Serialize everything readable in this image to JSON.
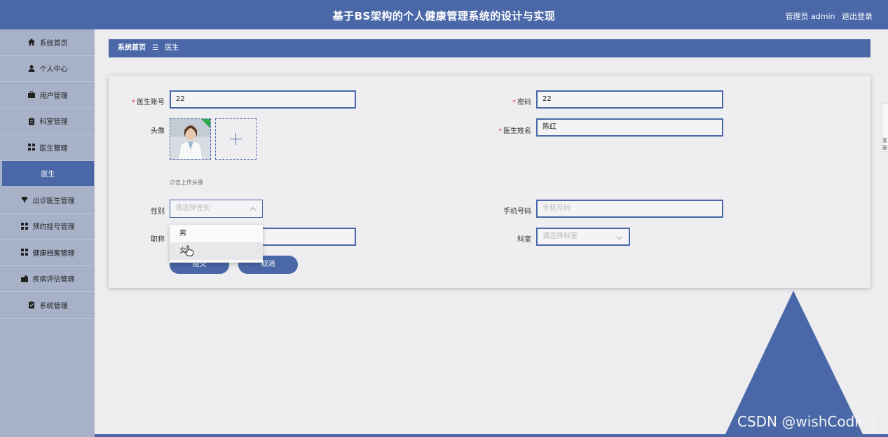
{
  "header": {
    "title": "基于BS架构的个人健康管理系统的设计与实现",
    "user_label": "管理员 admin",
    "logout_label": "退出登录"
  },
  "sidebar": {
    "items": [
      {
        "label": "系统首页",
        "icon": "home-icon"
      },
      {
        "label": "个人中心",
        "icon": "user-icon"
      },
      {
        "label": "用户管理",
        "icon": "briefcase-icon"
      },
      {
        "label": "科室管理",
        "icon": "clipboard-icon"
      },
      {
        "label": "医生管理",
        "icon": "grid-icon"
      },
      {
        "label": "医生",
        "icon": ""
      },
      {
        "label": "出诊医生管理",
        "icon": "cup-icon"
      },
      {
        "label": "预约挂号管理",
        "icon": "grid-icon"
      },
      {
        "label": "健康档案管理",
        "icon": "grid-icon"
      },
      {
        "label": "疾病评估管理",
        "icon": "briefcase-icon"
      },
      {
        "label": "系统管理",
        "icon": "clipboard-check-icon"
      }
    ],
    "active_index": 5
  },
  "breadcrumb": {
    "home": "系统首页",
    "separator": "☰",
    "current": "医生"
  },
  "form": {
    "doctor_account_label": "医生账号",
    "doctor_account_value": "22",
    "password_label": "密码",
    "password_value": "22",
    "avatar_label": "头像",
    "avatar_hint": "点击上传头像",
    "doctor_name_label": "医生姓名",
    "doctor_name_value": "陈红",
    "gender_label": "性别",
    "gender_placeholder": "请选择性别",
    "phone_label": "手机号码",
    "phone_placeholder": "手机号码",
    "title_label": "职称",
    "department_label": "科室",
    "department_placeholder": "请选择科室",
    "submit_label": "提交",
    "cancel_label": "取消",
    "gender_options": [
      "男",
      "女"
    ],
    "hovered_option_index": 1
  },
  "side_tab_label": "客服",
  "watermark": "CSDN @wishCoding",
  "colors": {
    "primary": "#4a68a8",
    "sidebar_bg": "#a7b2c9",
    "page_bg": "#ededf0",
    "required_star": "#e24b4b"
  }
}
